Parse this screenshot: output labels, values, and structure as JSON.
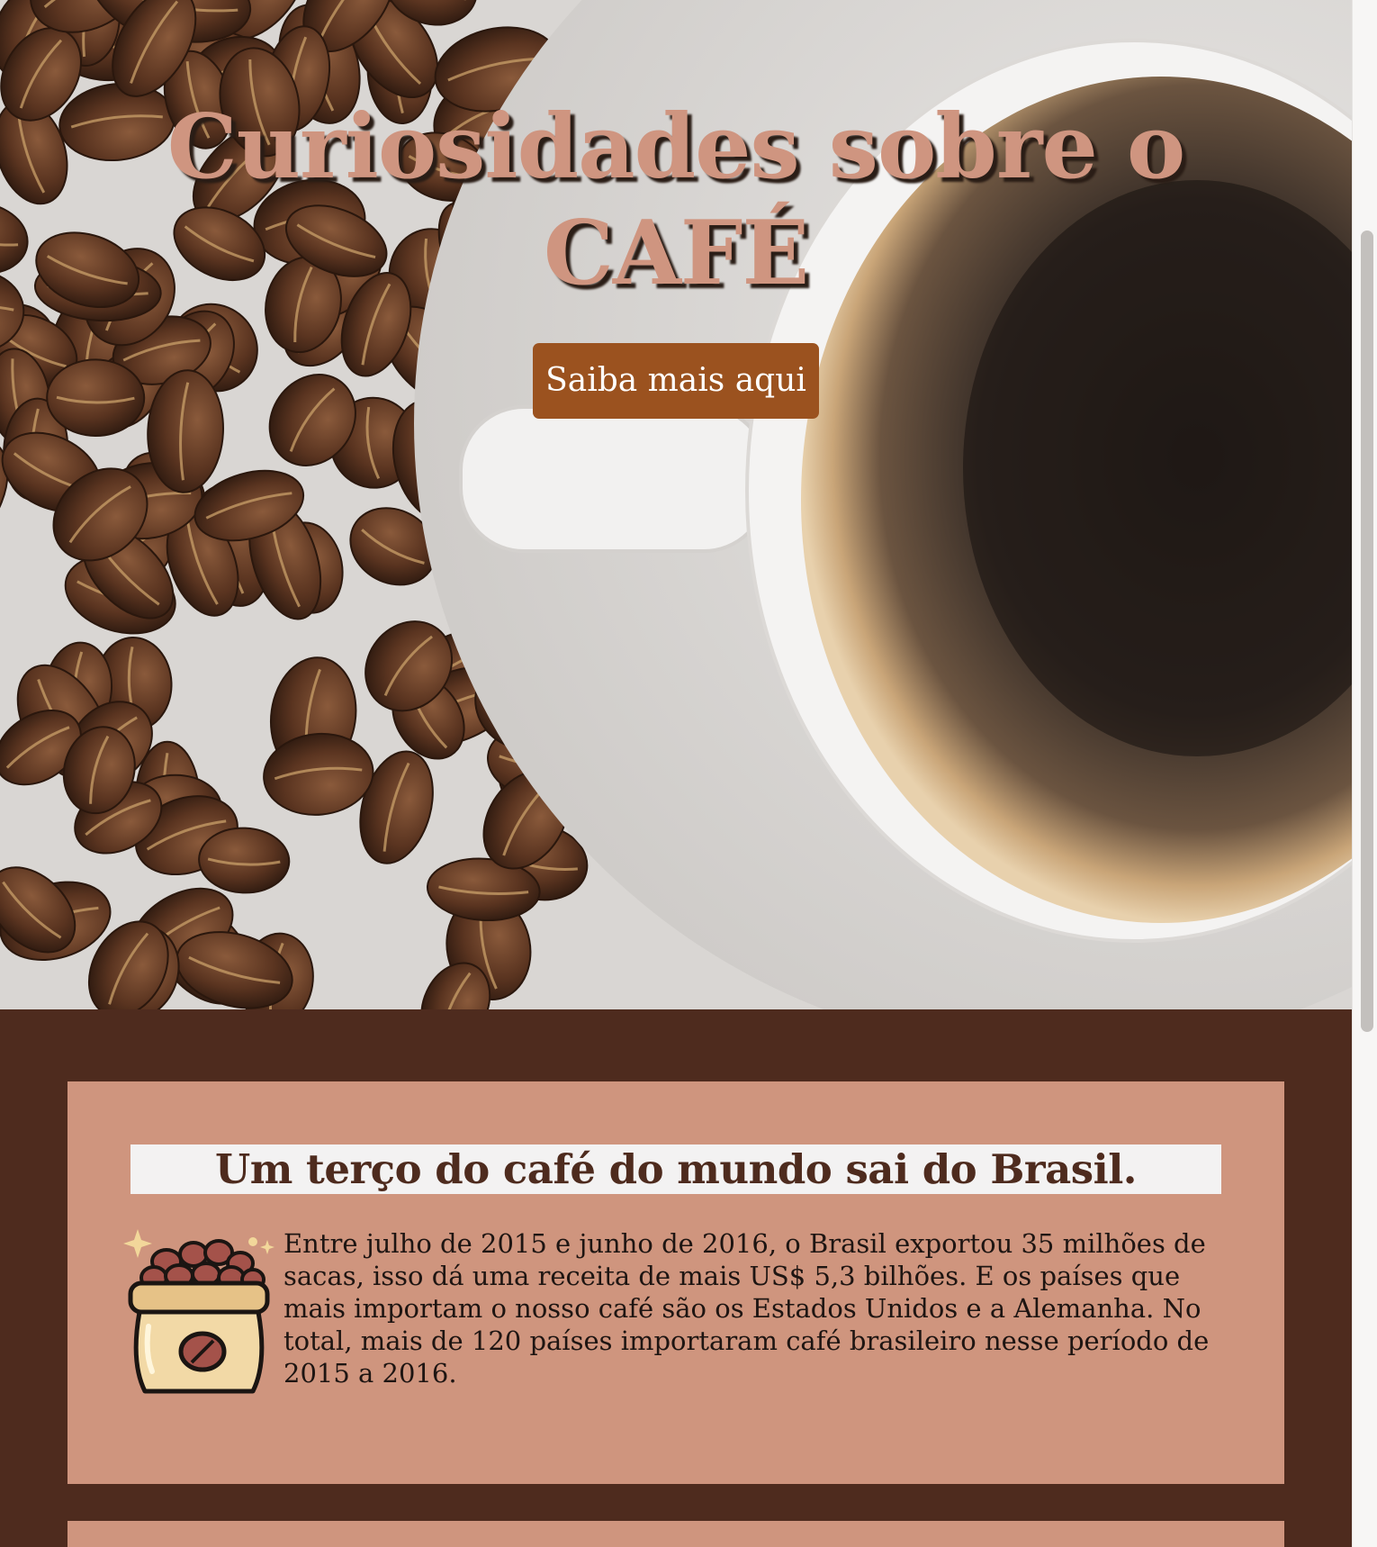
{
  "hero": {
    "title_line1": "Curiosidades sobre o",
    "title_line2": "CAFÉ",
    "cta_label": "Saiba mais aqui",
    "background": "coffee-cup-and-beans-photo"
  },
  "cards": [
    {
      "heading": "Um terço do café do mundo sai do Brasil.",
      "icon": "coffee-sack-icon",
      "text": "Entre julho de 2015 e junho de 2016, o Brasil exportou 35 milhões de sacas, isso dá uma receita de mais US$ 5,3 bilhões. E os países que mais importam o nosso café são os Estados Unidos e a Alemanha. No total, mais de 120 países importaram café brasileiro nesse período de 2015 a 2016."
    }
  ],
  "colors": {
    "title": "#cf9580",
    "button": "#9b521f",
    "section_bg": "#4e2b1e",
    "card_bg": "#cf957e",
    "heading_bg": "#f3f2f2",
    "heading_text": "#4e2b1e"
  }
}
